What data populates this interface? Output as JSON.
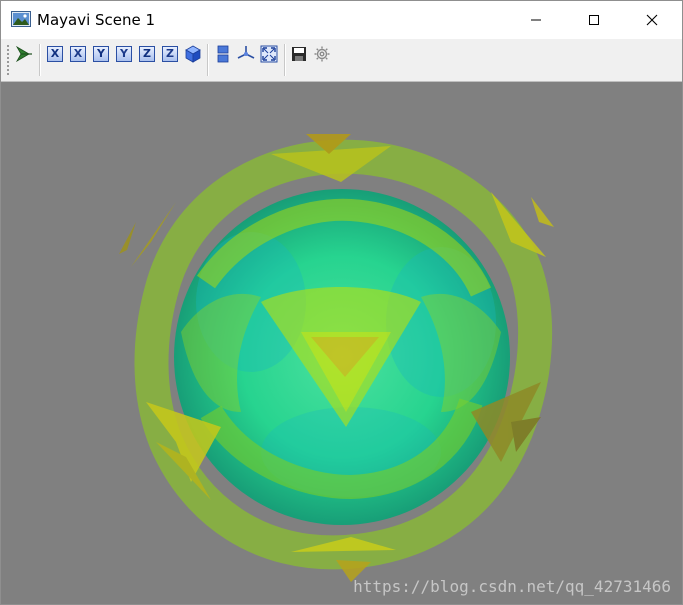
{
  "window": {
    "title": "Mayavi Scene 1",
    "controls": [
      "minimize",
      "maximize",
      "close"
    ]
  },
  "toolbar": {
    "tools": [
      {
        "id": "pipeline",
        "icon": "mayavi-pipeline-icon"
      },
      {
        "id": "view-x-neg",
        "label": "X",
        "icon": "view-axis-icon"
      },
      {
        "id": "view-x-pos",
        "label": "X",
        "icon": "view-axis-icon"
      },
      {
        "id": "view-y-neg",
        "label": "Y",
        "icon": "view-axis-icon"
      },
      {
        "id": "view-y-pos",
        "label": "Y",
        "icon": "view-axis-icon"
      },
      {
        "id": "view-z-neg",
        "label": "Z",
        "icon": "view-axis-icon"
      },
      {
        "id": "view-z-pos",
        "label": "Z",
        "icon": "view-axis-icon"
      },
      {
        "id": "isometric",
        "icon": "isometric-cube-icon"
      },
      {
        "id": "parallel-projection",
        "icon": "projection-icon"
      },
      {
        "id": "axes-indicator",
        "icon": "axes-icon"
      },
      {
        "id": "full-screen",
        "icon": "fullscreen-icon"
      },
      {
        "id": "save",
        "icon": "save-icon"
      },
      {
        "id": "configure",
        "icon": "gear-icon"
      }
    ]
  },
  "scene": {
    "background": "#808080",
    "watermark": "https://blog.csdn.net/qq_42731466"
  }
}
